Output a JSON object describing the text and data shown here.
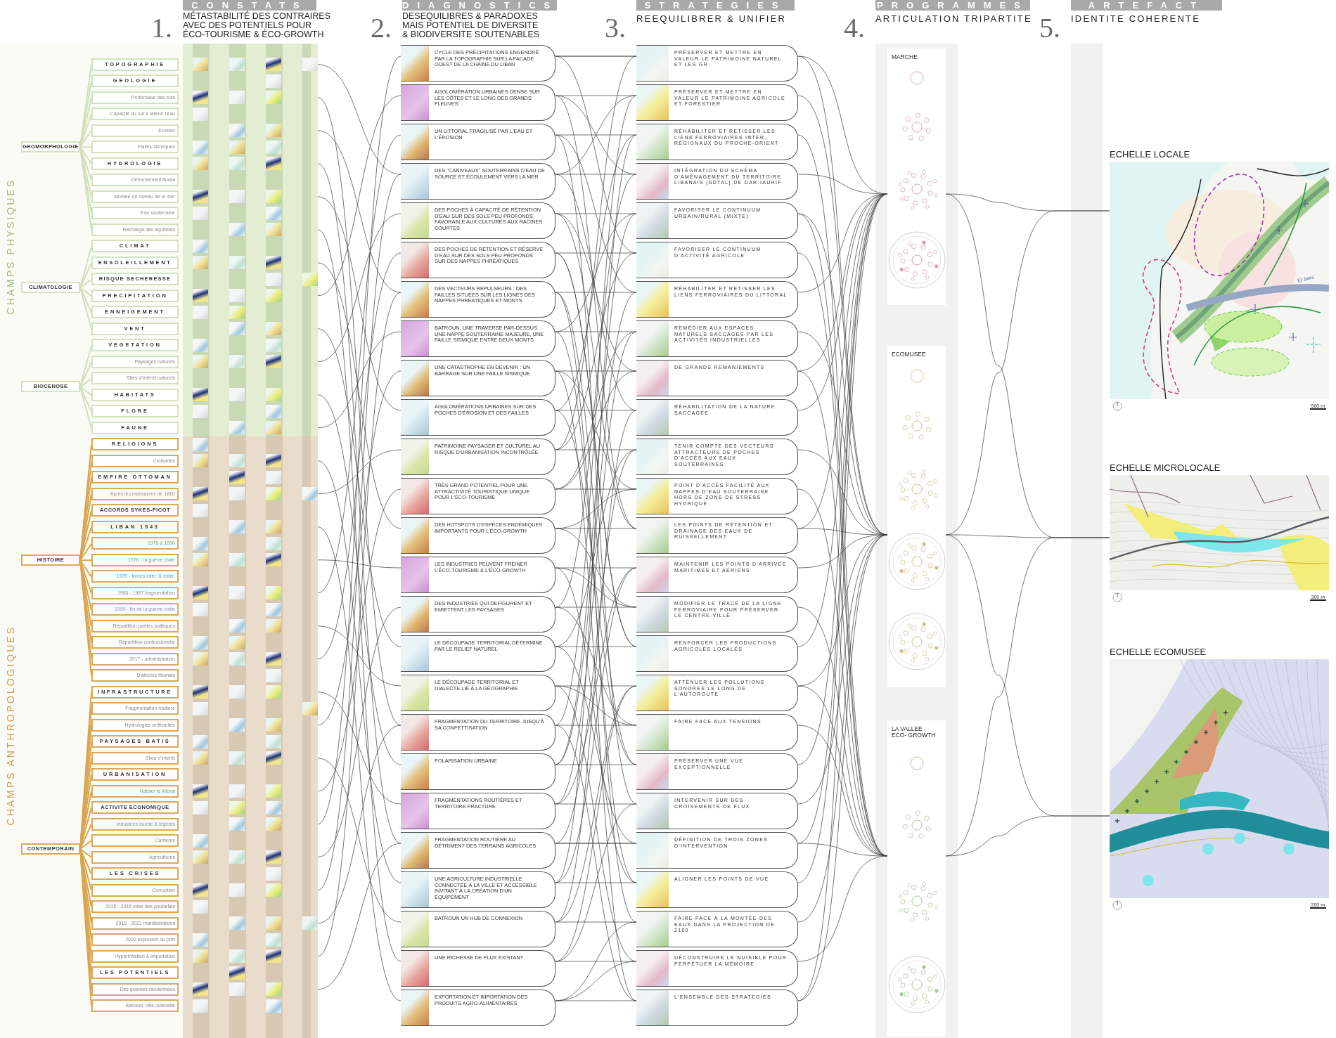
{
  "sections": [
    {
      "number": "1.",
      "banner": "CONSTATS",
      "title_lines": [
        "MÉTASTABILITÉ DES CONTRAIRES",
        "AVEC DES POTENTIELS POUR",
        "ÉCO-TOURISME & ÉCO-GROWTH"
      ]
    },
    {
      "number": "2.",
      "banner": "DIAGNOSTICS",
      "title_lines": [
        "DESEQUILIBRES & PARADOXES",
        "MAIS POTENTIEL DE DIVERSITE",
        "& BIODIVERSITE SOUTENABLES"
      ]
    },
    {
      "number": "3.",
      "banner": "STRATEGIES",
      "title_lines": [
        "REEQUILIBRER & UNIFIER"
      ]
    },
    {
      "number": "4.",
      "banner": "PROGRAMMES",
      "title_lines": [
        "ARTICULATION TRIPARTITE"
      ]
    },
    {
      "number": "5.",
      "banner": "ARTEFACT",
      "title_lines": [
        "IDENTITE COHERENTE"
      ]
    }
  ],
  "fields": [
    {
      "label": "CHAMPS PHYSIQUES",
      "kind": "physical",
      "groups": [
        {
          "label": "GEOMORPHOLOGIE",
          "items": [
            {
              "label": "TOPOGRAPHIE",
              "kind": "major"
            },
            {
              "label": "GEOLOGIE",
              "kind": "major"
            },
            {
              "label": "Profondeur des sols",
              "kind": "minor"
            },
            {
              "label": "Capacité du sol à retenir l'eau",
              "kind": "minor"
            },
            {
              "label": "Erosion",
              "kind": "minor"
            },
            {
              "label": "Failles sismiques",
              "kind": "minor"
            },
            {
              "label": "HYDROLOGIE",
              "kind": "major"
            },
            {
              "label": "Débordement fluvial",
              "kind": "minor"
            },
            {
              "label": "Montée du niveau de la mer",
              "kind": "minor"
            },
            {
              "label": "Eau souterraine",
              "kind": "minor"
            },
            {
              "label": "Recharge des aquifères",
              "kind": "minor"
            }
          ]
        },
        {
          "label": "CLIMATOLOGIE",
          "items": [
            {
              "label": "CLIMAT",
              "kind": "major"
            },
            {
              "label": "ENSOLEILLEMENT",
              "kind": "major"
            },
            {
              "label": "RISQUE SECHERESSE",
              "kind": "major"
            },
            {
              "label": "PRECIPITATION",
              "kind": "major"
            },
            {
              "label": "ENNEIGEMENT",
              "kind": "major"
            },
            {
              "label": "VENT",
              "kind": "major"
            }
          ]
        },
        {
          "label": "BIOCENOSE",
          "items": [
            {
              "label": "VEGETATION",
              "kind": "major"
            },
            {
              "label": "Paysages naturels",
              "kind": "minor"
            },
            {
              "label": "Sites d'intérêt naturels",
              "kind": "minor"
            },
            {
              "label": "HABITATS",
              "kind": "major"
            },
            {
              "label": "FLORE",
              "kind": "major"
            },
            {
              "label": "FAUNE",
              "kind": "major"
            }
          ]
        }
      ]
    },
    {
      "label": "CHAMPS ANTHROPOLOGIQUES",
      "kind": "anthropological",
      "groups": [
        {
          "label": "HISTOIRE",
          "items": [
            {
              "label": "RELIGIONS",
              "kind": "major"
            },
            {
              "label": "Croisades",
              "kind": "minor"
            },
            {
              "label": "EMPIRE OTTOMAN",
              "kind": "major"
            },
            {
              "label": "Après les massacres de 1860",
              "kind": "minor"
            },
            {
              "label": "ACCORDS SYKES-PICOT",
              "kind": "major"
            },
            {
              "label": "LIBAN 1943",
              "kind": "major"
            },
            {
              "label": "1975 à 1990",
              "kind": "minor"
            },
            {
              "label": "1976 - la guerre civile",
              "kind": "minor"
            },
            {
              "label": "1978 - forces intér. & extér.",
              "kind": "minor"
            },
            {
              "label": "1986 - 1987 fragmentation",
              "kind": "minor"
            },
            {
              "label": "1990 - fin de la guerre civile",
              "kind": "minor"
            },
            {
              "label": "Répartition parties politiques",
              "kind": "minor"
            },
            {
              "label": "Répartition confessionelle",
              "kind": "minor"
            },
            {
              "label": "2017 - administration",
              "kind": "minor"
            },
            {
              "label": "Dialectes libanais",
              "kind": "minor"
            }
          ]
        },
        {
          "label": "CONTEMPORAIN",
          "items": [
            {
              "label": "INFRASTRUCTURE",
              "kind": "major"
            },
            {
              "label": "Fragmentation routière",
              "kind": "minor"
            },
            {
              "label": "Hydrologies artificielles",
              "kind": "minor"
            },
            {
              "label": "PAYSAGES BATIS",
              "kind": "major"
            },
            {
              "label": "Sites d'intérêt",
              "kind": "minor"
            },
            {
              "label": "URBANISATION",
              "kind": "major"
            },
            {
              "label": "Habiter le littoral",
              "kind": "minor"
            },
            {
              "label": "ACTIVITE ECONOMIQUE",
              "kind": "major"
            },
            {
              "label": "Industries lourde & légères",
              "kind": "minor"
            },
            {
              "label": "Carrières",
              "kind": "minor"
            },
            {
              "label": "Agricultures",
              "kind": "minor"
            },
            {
              "label": "LES CRISES",
              "kind": "major"
            },
            {
              "label": "Corruption",
              "kind": "minor"
            },
            {
              "label": "2015 - 2016 crise des poubelles",
              "kind": "minor"
            },
            {
              "label": "2019 - 2021 manifestations",
              "kind": "minor"
            },
            {
              "label": "2020 explosion du port",
              "kind": "minor"
            },
            {
              "label": "Hyperinflation & importation",
              "kind": "minor"
            },
            {
              "label": "LES POTENTIELS",
              "kind": "major"
            },
            {
              "label": "Des grandes randonnées",
              "kind": "minor"
            },
            {
              "label": "Batroun, ville culturelle",
              "kind": "minor"
            }
          ]
        }
      ]
    }
  ],
  "diagnostics": [
    "CYCLE DES PRÉCIPITATIONS ENGENDRÉ PAR LA TOPOGRAPHIE SUR LA FACADE OUEST DE LA CHAINE DU LIBAN",
    "AGGLOMÉRATION URBAINES DENSE SUR LES CÔTES ET LE LONG DES GRANDS FLEUVES",
    "UN LITTORAL FRAGILISÉ PAR L'EAU ET L'ÉROSION",
    "DES \"CANIVEAUX\" SOUTERRAINS D'EAU DE SOURCE ET ÉCOULEMENT VERS LA MER",
    "DES POCHES À CAPACITÉ DE RÉTENTION D'EAU SUR DES SOLS PEU PROFONDS FAVORABLE AUX CULTURES AUX RACINES COURTES",
    "DES POCHES DE RÉTENTION ET RÉSERVE D'EAU SUR DES SOLS PEU PROFONDS SUR DES NAPPES PHRÉATIQUES",
    "DES VECTEURS REPULSEURS : DES FAILLES SITUÉES SUR LES LIGNES DES NAPPES PHRÉATIQUES ET MONTS",
    "BATROUN, UNE TRAVERSE PAR-DESSUS UNE NAPPE SOUTERRAINE MAJEURE, UNE FAILLE SISMIQUE ENTRE DEUX MONTS",
    "UNE CATASTROPHE EN DEVENIR : UN BARRAGE SUR UNE FAILLE SISMIQUE",
    "AGGLOMÉRATIONS URBAINES SUR DES POCHES D'ÉROSION ET DES FAILLES",
    "PATRIMOINE PAYSAGER ET CULTUREL AU RISQUE D'URBANISATION INCONTRÔLÉE",
    "TRÈS GRAND POTENTIEL POUR UNE ATTRACTIVITÉ TOURISTIQUE UNIQUE POUR L'ÉCO-TOURISME",
    "DES HOTSPOTS D'ESPÈCES ENDÉMIQUES IMPORTANTS POUR L'ÉCO-GROWTH",
    "LES INDUSTRIES PEUVENT FREINER L'ÉCO-TOURISME & L'ÉCO-GROWTH",
    "DES INDUSTRIES QUI DEFIGURENT ET EMIETTENT LES PAYSAGES",
    "LE DÉCOUPAGE TERRITORIAL DÉTERMINÉ PAR LE RELIEF NATUREL",
    "LE DÉCOUPAGE TERRITORIAL ET DIALECTE LIÉ À LA GÉOGRAPHIE",
    "FRAGMENTATION DU TERRITOIRE JUSQU'À SA CONFETTISATION",
    "POLARISATION URBAINE",
    "FRAGMENTATIONS ROUTIÈRES ET TERRITOIRE FRACTURE",
    "FRAGMENTATION ROUTIÈRE AU DÉTRIMENT DES TERRAINS AGRICOLES",
    "UNE AGRICULTURE INDUSTRIELLE CONNECTÉE À LA VILLE ET ACCESSIBLE INVITANT À LA CRÉATION D'UN ÉQUIPEMENT",
    "BATROUN UN HUB DE CONNEXION",
    "UNE RICHESSE DE FLUX EXISTANT",
    "EXPORTATION ET IMPORTATION DES PRODUITS AGRO-ALIMENTAIRES"
  ],
  "strategies": [
    "PRÉSERVER ET METTRE EN VALEUR LE PATRIMOINE NATUREL ET LES GR",
    "PRÉSERVER ET METTRE EN VALEUR LE PATRIMOINE AGRICOLE ET FORESTIER",
    "RÉHABILITER ET RETISSER LES LIENS FERROVIAIRES INTER-RÉGIONAUX DU PROCHE-ORIENT",
    "INTÉGRATION DU SCHÉMA D'AMÉNAGEMENT DU TERRITOIRE LIBANAIS (SDTAL) DE DAR-IAURIF",
    "FAVORISER LE CONTINUUM URBAIN/RURAL (MIXTE)",
    "FAVORISER LE CONTINUUM D'ACTIVITÉ AGRICOLE",
    "RÉHABILITER ET RETISSER LES LIENS FERROVIAIRES DU LITTORAL",
    "REMÉDIER AUX ESPACES NATURELS SACCAGÉS PAR LES ACTIVITÉS INDUSTRIELLES",
    "DE GRANDS REMANIEMENTS",
    "RÉHABILITATION DE LA NATURE SACCAGÉE",
    "TENIR COMPTE DES VECTEURS ATTRACTEURS DE POCHES D'ACCÈS AUX EAUX SOUTERRAINES",
    "POINT D'ACCÈS FACILITÉ AUX NAPPES D'EAU SOUTERRAINE HORS DE ZONE DE STRESS HYDRIQUE",
    "LES POINTS DE RÉTENTION ET DRAINAGE DES EAUX DE RUISSELLEMENT",
    "MAINTENIR LES POINTS D'ARRIVÉE MARITIMES ET AÉRIENS",
    "MODIFIER LE TRACÉ DE LA LIGNE FERROVIAIRE POUR PRÉSERVER LE CENTRE-VILLE",
    "RENFORCER LES PRODUCTIONS AGRICOLES LOCALES",
    "ATTÉNUER LES POLLUTIONS SONORES LE LONG DE L'AUTOROUTE",
    "FAIRE FACE AUX TENSIONS",
    "PRÉSERVER UNE VUE EXCEPTIONNELLE",
    "INTERVENIR SUR DES CROISEMENTS DE FLUX",
    "DÉFINITION DE TROIS ZONES D'INTERVENTION",
    "ALIGNER LES POINTS DE VUE",
    "FAIRE FACE À LA MONTÉE DES EAUX DANS LA PROJECTION DE 2100",
    "DÉCONSTRUIRE LE NUISIBLE POUR PERPÉTUER LA MÉMOIRE",
    "L'ENSEMBLE DES STRATEGIES"
  ],
  "programmes": [
    {
      "title_lines": [
        "MARCHE"
      ]
    },
    {
      "title_lines": [
        "ECOMUSEE"
      ]
    },
    {
      "title_lines": [
        "LA VALLEE",
        "ECO- GROWTH"
      ]
    }
  ],
  "maps": [
    {
      "title": "ECHELLE LOCALE",
      "kind": "local",
      "scale": "500 m",
      "label": "El Jawz"
    },
    {
      "title": "ECHELLE MICROLOCALE",
      "kind": "micro",
      "scale": "300 m"
    },
    {
      "title": "ECHELLE ECOMUSEE",
      "kind": "ecomusee",
      "scale": "200 m"
    }
  ]
}
